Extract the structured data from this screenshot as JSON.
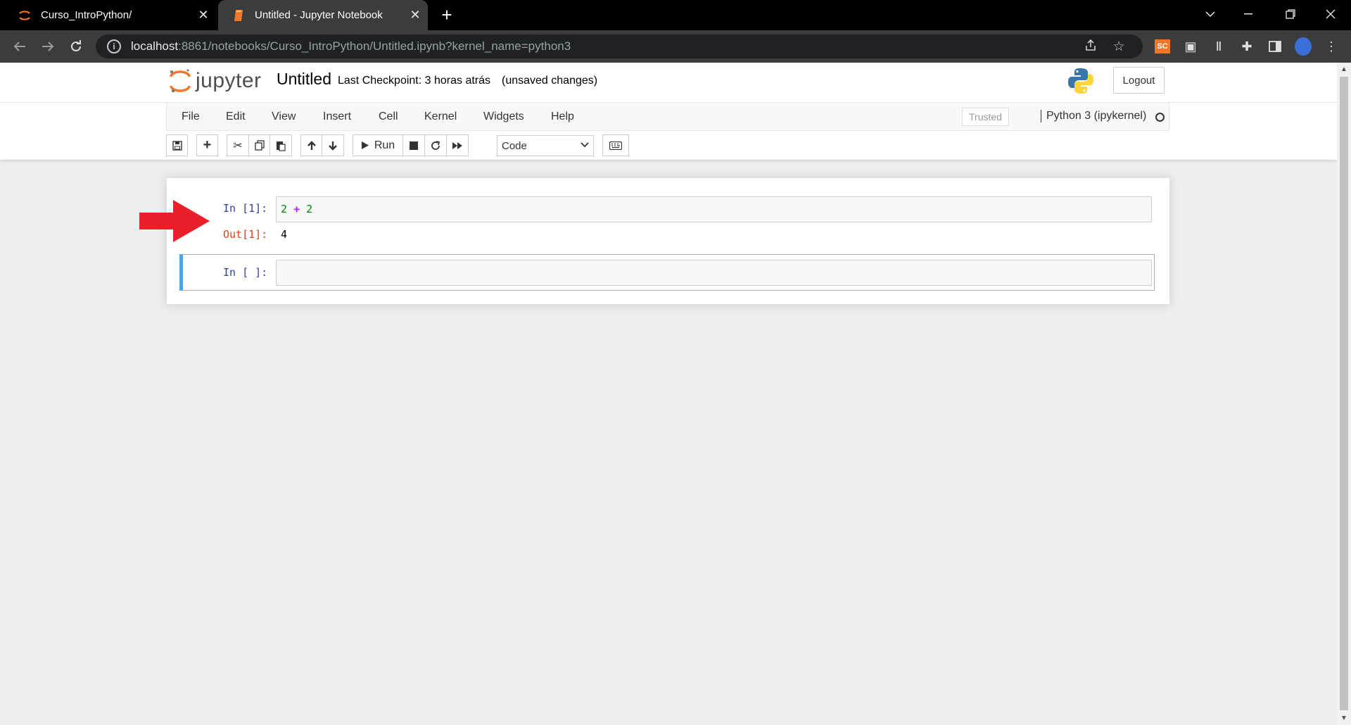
{
  "browser": {
    "tabs": [
      {
        "title": "Curso_IntroPython/",
        "active": false
      },
      {
        "title": "Untitled - Jupyter Notebook",
        "active": true
      }
    ],
    "url_host": "localhost",
    "url_rest": ":8861/notebooks/Curso_IntroPython/Untitled.ipynb?kernel_name=python3",
    "extension_badge": "SC"
  },
  "jupyter": {
    "logo_text": "jupyter",
    "notebook_title": "Untitled",
    "checkpoint": "Last Checkpoint: 3 horas atrás",
    "unsaved": "(unsaved changes)",
    "logout_label": "Logout",
    "menu": [
      "File",
      "Edit",
      "View",
      "Insert",
      "Cell",
      "Kernel",
      "Widgets",
      "Help"
    ],
    "trusted_label": "Trusted",
    "kernel_name": "Python 3 (ipykernel)",
    "toolbar": {
      "run_label": "Run",
      "cell_type": "Code"
    }
  },
  "cells": [
    {
      "in_prompt": "In [1]:",
      "code_a": "2",
      "code_op": "+",
      "code_b": "2",
      "out_prompt": "Out[1]:",
      "output": "4"
    },
    {
      "in_prompt": "In [ ]:",
      "code": ""
    }
  ],
  "colors": {
    "jupyter_orange": "#f37726",
    "selected_border": "#42a5f5",
    "in_prompt": "#303f9f",
    "out_prompt": "#d84315",
    "annotation_arrow": "#e8202a"
  }
}
